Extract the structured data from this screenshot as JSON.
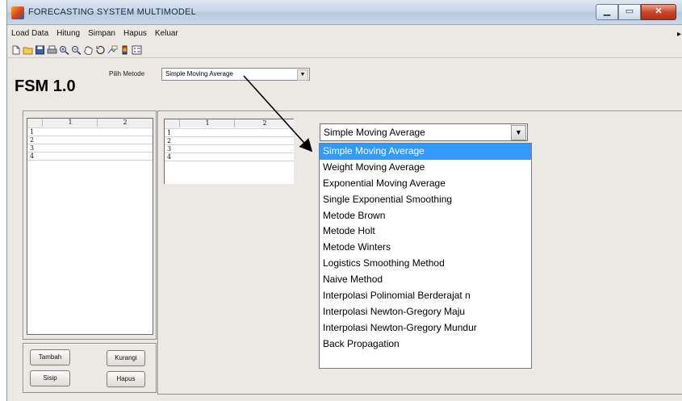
{
  "window": {
    "title": "FORECASTING SYSTEM MULTIMODEL",
    "controls": {
      "minimize": "▁",
      "maximize": "▭",
      "close": "✕"
    }
  },
  "menubar": {
    "items": [
      {
        "label": "Load Data"
      },
      {
        "label": "Hitung"
      },
      {
        "label": "Simpan"
      },
      {
        "label": "Hapus"
      },
      {
        "label": "Keluar"
      }
    ],
    "overflow": "▸"
  },
  "toolbar": {
    "icons": [
      "new-file-icon",
      "open-folder-icon",
      "save-icon",
      "print-icon",
      "zoom-in-icon",
      "zoom-out-icon",
      "pan-hand-icon",
      "rotate-3d-icon",
      "data-cursor-icon",
      "colorbar-icon",
      "legend-icon"
    ]
  },
  "app_label": "FSM 1.0",
  "metode": {
    "label": "Pilih Metode",
    "selected": "Simple Moving Average",
    "arrow": "▼"
  },
  "left_table": {
    "columns": [
      "1",
      "2"
    ],
    "rows": [
      "1",
      "2",
      "3",
      "4"
    ]
  },
  "right_table": {
    "columns": [
      "1",
      "2"
    ],
    "rows": [
      "1",
      "2",
      "3",
      "4"
    ]
  },
  "buttons": {
    "tambah": "Tambah",
    "kurangi": "Kurangi",
    "sisip": "Sisip",
    "hapus": "Hapus"
  },
  "dropdown": {
    "selected": "Simple Moving Average",
    "arrow": "▼",
    "options": [
      "Simple Moving Average",
      "Weight Moving Average",
      "Exponential Moving Average",
      "Single Exponential Smoothing",
      "Metode Brown",
      "Metode Holt",
      "Metode Winters",
      "Logistics Smoothing Method",
      "Naive Method",
      "Interpolasi Polinomial Berderajat n",
      "Interpolasi Newton-Gregory Maju",
      "Interpolasi Newton-Gregory Mundur",
      "Back Propagation"
    ],
    "highlighted_index": 0,
    "highlight_color": "#3299fd"
  }
}
